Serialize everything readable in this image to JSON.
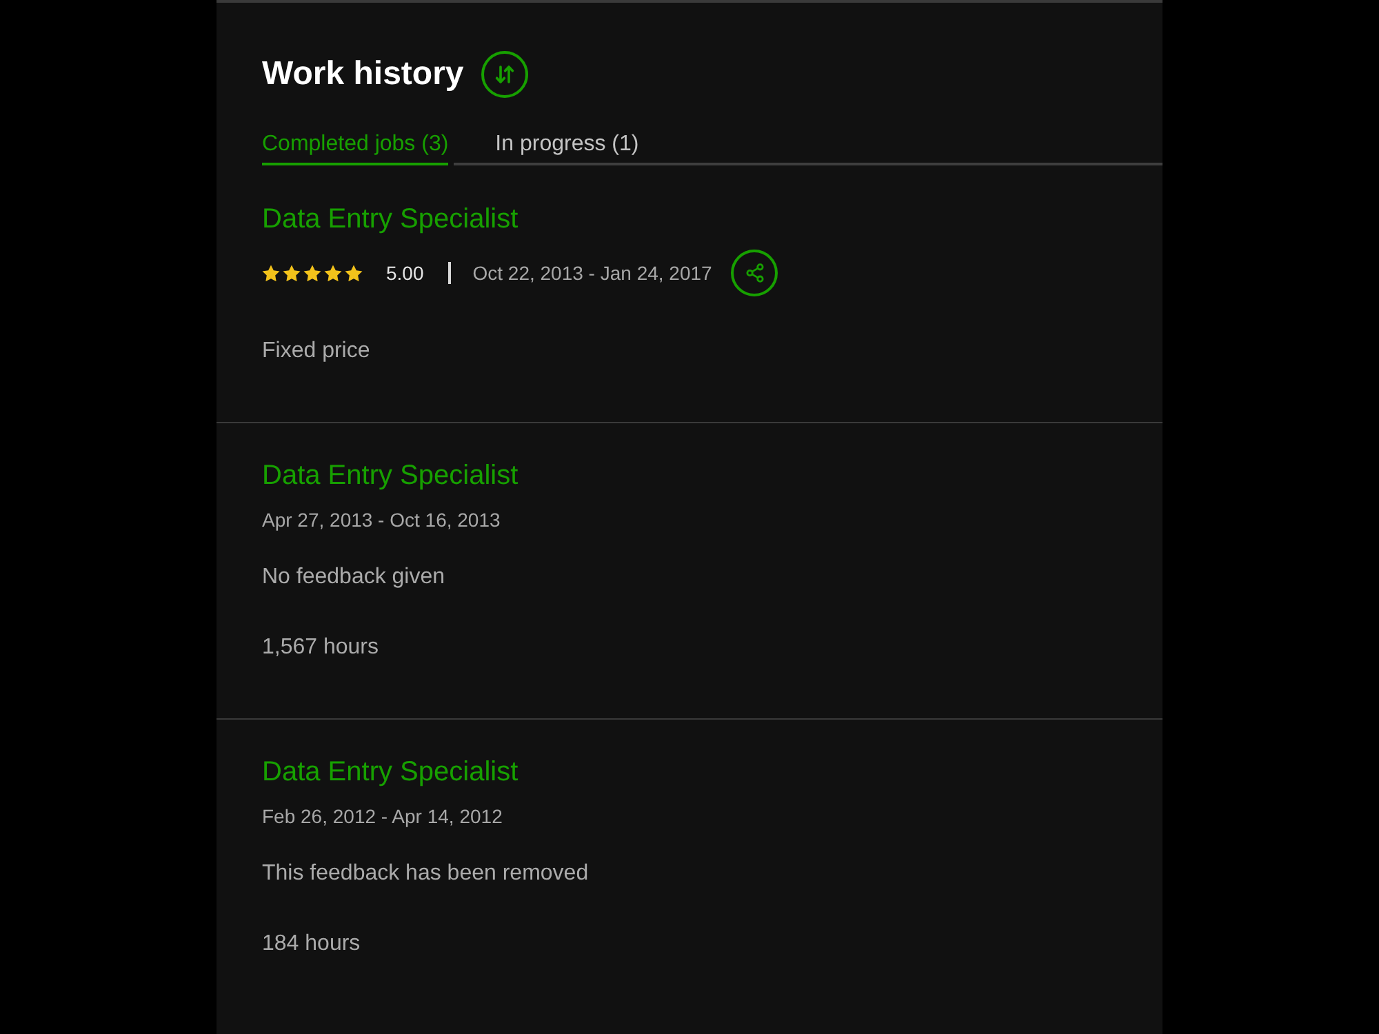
{
  "header": {
    "title": "Work history"
  },
  "tabs": [
    {
      "label": "Completed jobs (3)",
      "selected": true
    },
    {
      "label": "In progress (1)",
      "selected": false
    }
  ],
  "jobs": [
    {
      "title": "Data Entry Specialist",
      "stars": 5,
      "rating": "5.00",
      "dates": "Oct 22, 2013 - Jan 24, 2017",
      "share_button": true,
      "detail": "Fixed price"
    },
    {
      "title": "Data Entry Specialist",
      "dates": "Apr 27, 2013 - Oct 16, 2013",
      "share_button": false,
      "feedback": "No feedback given",
      "detail": "1,567 hours"
    },
    {
      "title": "Data Entry Specialist",
      "dates": "Feb 26, 2012 - Apr 14, 2012",
      "share_button": false,
      "feedback": "This feedback has been removed",
      "detail": "184 hours"
    }
  ]
}
